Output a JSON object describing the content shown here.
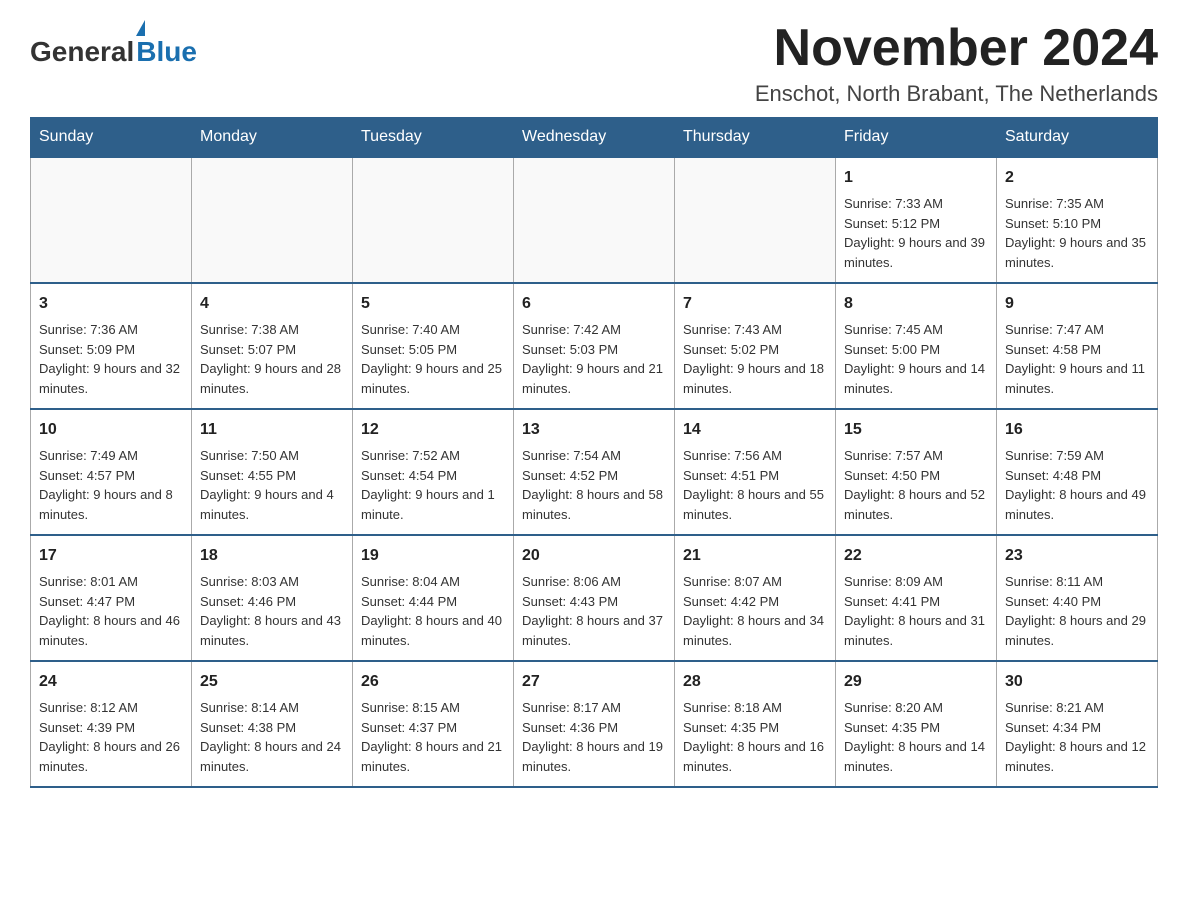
{
  "header": {
    "logo_general": "General",
    "logo_blue": "Blue",
    "month_year": "November 2024",
    "location": "Enschot, North Brabant, The Netherlands"
  },
  "days_of_week": [
    "Sunday",
    "Monday",
    "Tuesday",
    "Wednesday",
    "Thursday",
    "Friday",
    "Saturday"
  ],
  "weeks": [
    [
      {
        "day": "",
        "info": ""
      },
      {
        "day": "",
        "info": ""
      },
      {
        "day": "",
        "info": ""
      },
      {
        "day": "",
        "info": ""
      },
      {
        "day": "",
        "info": ""
      },
      {
        "day": "1",
        "info": "Sunrise: 7:33 AM\nSunset: 5:12 PM\nDaylight: 9 hours and 39 minutes."
      },
      {
        "day": "2",
        "info": "Sunrise: 7:35 AM\nSunset: 5:10 PM\nDaylight: 9 hours and 35 minutes."
      }
    ],
    [
      {
        "day": "3",
        "info": "Sunrise: 7:36 AM\nSunset: 5:09 PM\nDaylight: 9 hours and 32 minutes."
      },
      {
        "day": "4",
        "info": "Sunrise: 7:38 AM\nSunset: 5:07 PM\nDaylight: 9 hours and 28 minutes."
      },
      {
        "day": "5",
        "info": "Sunrise: 7:40 AM\nSunset: 5:05 PM\nDaylight: 9 hours and 25 minutes."
      },
      {
        "day": "6",
        "info": "Sunrise: 7:42 AM\nSunset: 5:03 PM\nDaylight: 9 hours and 21 minutes."
      },
      {
        "day": "7",
        "info": "Sunrise: 7:43 AM\nSunset: 5:02 PM\nDaylight: 9 hours and 18 minutes."
      },
      {
        "day": "8",
        "info": "Sunrise: 7:45 AM\nSunset: 5:00 PM\nDaylight: 9 hours and 14 minutes."
      },
      {
        "day": "9",
        "info": "Sunrise: 7:47 AM\nSunset: 4:58 PM\nDaylight: 9 hours and 11 minutes."
      }
    ],
    [
      {
        "day": "10",
        "info": "Sunrise: 7:49 AM\nSunset: 4:57 PM\nDaylight: 9 hours and 8 minutes."
      },
      {
        "day": "11",
        "info": "Sunrise: 7:50 AM\nSunset: 4:55 PM\nDaylight: 9 hours and 4 minutes."
      },
      {
        "day": "12",
        "info": "Sunrise: 7:52 AM\nSunset: 4:54 PM\nDaylight: 9 hours and 1 minute."
      },
      {
        "day": "13",
        "info": "Sunrise: 7:54 AM\nSunset: 4:52 PM\nDaylight: 8 hours and 58 minutes."
      },
      {
        "day": "14",
        "info": "Sunrise: 7:56 AM\nSunset: 4:51 PM\nDaylight: 8 hours and 55 minutes."
      },
      {
        "day": "15",
        "info": "Sunrise: 7:57 AM\nSunset: 4:50 PM\nDaylight: 8 hours and 52 minutes."
      },
      {
        "day": "16",
        "info": "Sunrise: 7:59 AM\nSunset: 4:48 PM\nDaylight: 8 hours and 49 minutes."
      }
    ],
    [
      {
        "day": "17",
        "info": "Sunrise: 8:01 AM\nSunset: 4:47 PM\nDaylight: 8 hours and 46 minutes."
      },
      {
        "day": "18",
        "info": "Sunrise: 8:03 AM\nSunset: 4:46 PM\nDaylight: 8 hours and 43 minutes."
      },
      {
        "day": "19",
        "info": "Sunrise: 8:04 AM\nSunset: 4:44 PM\nDaylight: 8 hours and 40 minutes."
      },
      {
        "day": "20",
        "info": "Sunrise: 8:06 AM\nSunset: 4:43 PM\nDaylight: 8 hours and 37 minutes."
      },
      {
        "day": "21",
        "info": "Sunrise: 8:07 AM\nSunset: 4:42 PM\nDaylight: 8 hours and 34 minutes."
      },
      {
        "day": "22",
        "info": "Sunrise: 8:09 AM\nSunset: 4:41 PM\nDaylight: 8 hours and 31 minutes."
      },
      {
        "day": "23",
        "info": "Sunrise: 8:11 AM\nSunset: 4:40 PM\nDaylight: 8 hours and 29 minutes."
      }
    ],
    [
      {
        "day": "24",
        "info": "Sunrise: 8:12 AM\nSunset: 4:39 PM\nDaylight: 8 hours and 26 minutes."
      },
      {
        "day": "25",
        "info": "Sunrise: 8:14 AM\nSunset: 4:38 PM\nDaylight: 8 hours and 24 minutes."
      },
      {
        "day": "26",
        "info": "Sunrise: 8:15 AM\nSunset: 4:37 PM\nDaylight: 8 hours and 21 minutes."
      },
      {
        "day": "27",
        "info": "Sunrise: 8:17 AM\nSunset: 4:36 PM\nDaylight: 8 hours and 19 minutes."
      },
      {
        "day": "28",
        "info": "Sunrise: 8:18 AM\nSunset: 4:35 PM\nDaylight: 8 hours and 16 minutes."
      },
      {
        "day": "29",
        "info": "Sunrise: 8:20 AM\nSunset: 4:35 PM\nDaylight: 8 hours and 14 minutes."
      },
      {
        "day": "30",
        "info": "Sunrise: 8:21 AM\nSunset: 4:34 PM\nDaylight: 8 hours and 12 minutes."
      }
    ]
  ]
}
